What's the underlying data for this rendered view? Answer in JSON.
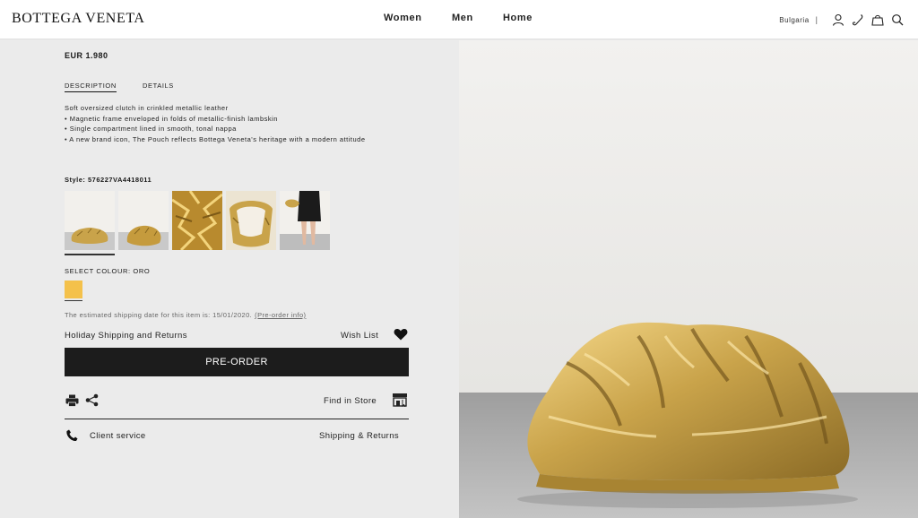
{
  "header": {
    "logo": "BOTTEGA VENETA",
    "nav": [
      "Women",
      "Men",
      "Home"
    ],
    "country": "Bulgaria",
    "separator": "|",
    "icons": [
      "user-icon",
      "phone-icon",
      "bag-icon",
      "search-icon"
    ]
  },
  "product": {
    "price": "EUR 1.980",
    "tabs": [
      "DESCRIPTION",
      "DETAILS"
    ],
    "active_tab": "DESCRIPTION",
    "description": [
      "Soft oversized clutch in crinkled metallic leather",
      "• Magnetic frame enveloped in folds of metallic-finish lambskin",
      "• Single compartment lined in smooth, tonal nappa",
      "• A new brand icon, The Pouch reflects Bottega Veneta's heritage with a modern attitude"
    ],
    "style": "Style: 576227VA4418011",
    "thumbnails": [
      "pouch-side-view",
      "pouch-angle-view",
      "pouch-closeup",
      "pouch-open-interior",
      "pouch-worn-model"
    ],
    "colour_label": "SELECT COLOUR: ORO",
    "swatch_color": "#f4c14b",
    "shipping_date": "The estimated shipping date for this item is: 15/01/2020.",
    "preorder_info": "(Pre-order info)",
    "holiday": "Holiday Shipping and Returns",
    "wishlist": "Wish List",
    "preorder_button": "PRE-ORDER",
    "find_in_store": "Find in Store",
    "client_service": "Client service",
    "shipping_returns": "Shipping & Returns"
  },
  "image": {
    "subject": "gold-pouch-clutch",
    "accent": "#c9a34a"
  }
}
